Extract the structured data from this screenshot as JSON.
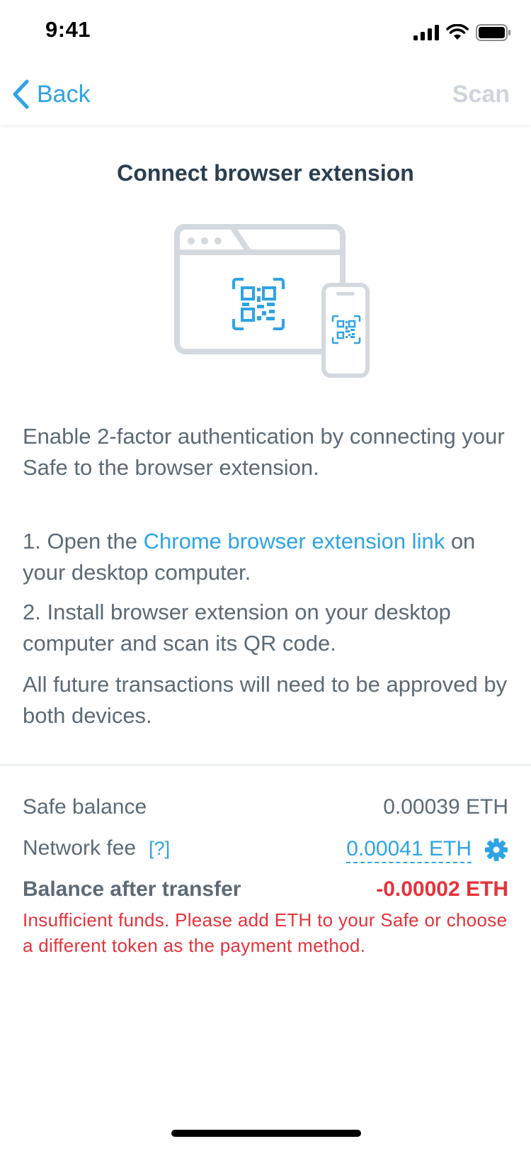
{
  "status_bar": {
    "time": "9:41"
  },
  "nav": {
    "back_label": "Back",
    "scan_label": "Scan"
  },
  "main": {
    "title": "Connect browser extension",
    "intro": "Enable 2-factor authentication by connecting your Safe to the browser extension.",
    "step1_prefix": "1. Open the ",
    "step1_link": "Chrome browser extension link",
    "step1_suffix": " on your desktop computer.",
    "step2": "2. Install browser extension on your desktop computer and scan its QR code.",
    "note": "All future transactions will need to be approved by both devices."
  },
  "summary": {
    "safe_balance_label": "Safe balance",
    "safe_balance_value": "0.00039 ETH",
    "network_fee_label": "Network fee",
    "network_fee_help": "[?]",
    "network_fee_value": "0.00041 ETH",
    "balance_after_label": "Balance after transfer",
    "balance_after_value": "-0.00002 ETH",
    "error": "Insufficient funds. Please add ETH to your Safe or choose a different token as the payment method."
  },
  "colors": {
    "accent": "#2ea3e6",
    "error": "#e5333b",
    "title": "#2b3e50",
    "body_text": "#5c6a76",
    "illustration_gray": "#d4d9e0",
    "disabled": "#cfd5db"
  },
  "icons": [
    "cellular-signal-icon",
    "wifi-icon",
    "battery-icon",
    "chevron-left-icon",
    "browser-window-icon",
    "qr-code-icon",
    "phone-icon",
    "gear-icon"
  ]
}
